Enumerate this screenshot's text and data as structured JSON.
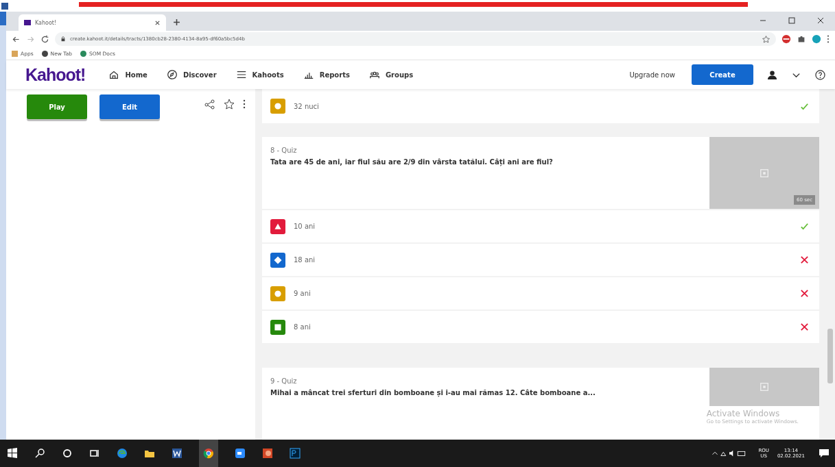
{
  "browser": {
    "tab_title": "Kahoot!",
    "url": "create.kahoot.it/details/tracts/1380cb28-2380-4134-8a95-df60a5bc5d4b",
    "bookmarks": [
      "Apps",
      "New Tab",
      "SOM Docs"
    ]
  },
  "nav": {
    "logo": "Kahoot!",
    "items": [
      {
        "label": "Home"
      },
      {
        "label": "Discover"
      },
      {
        "label": "Kahoots"
      },
      {
        "label": "Reports"
      },
      {
        "label": "Groups"
      }
    ],
    "upgrade": "Upgrade now",
    "create": "Create"
  },
  "sidebar": {
    "play": "Play",
    "edit": "Edit"
  },
  "previous_answers": [
    {
      "text": "32 nuci",
      "kind": "circle",
      "color": "#d89e00",
      "correct": true
    }
  ],
  "questions": [
    {
      "label": "8 - Quiz",
      "text": "Tata are 45 de ani, iar fiul său are 2/9 din vârsta tatălui. Câți ani are fiul?",
      "time": "60 sec",
      "answers": [
        {
          "text": "10 ani",
          "kind": "triangle",
          "color": "#e21b3c",
          "correct": true
        },
        {
          "text": "18 ani",
          "kind": "diamond",
          "color": "#1368ce",
          "correct": false
        },
        {
          "text": "9 ani",
          "kind": "circle",
          "color": "#d89e00",
          "correct": false
        },
        {
          "text": "8 ani",
          "kind": "square",
          "color": "#26890c",
          "correct": false
        }
      ]
    },
    {
      "label": "9 - Quiz",
      "text": "Mihai a mâncat trei sferturi din bomboane și i-au mai rămas 12. Câte bomboane a..."
    }
  ],
  "watermark": {
    "title": "Activate Windows",
    "subtitle": "Go to Settings to activate Windows."
  },
  "taskbar": {
    "language": "ROU",
    "layout": "US",
    "time": "13:14",
    "date": "02.02.2021"
  }
}
